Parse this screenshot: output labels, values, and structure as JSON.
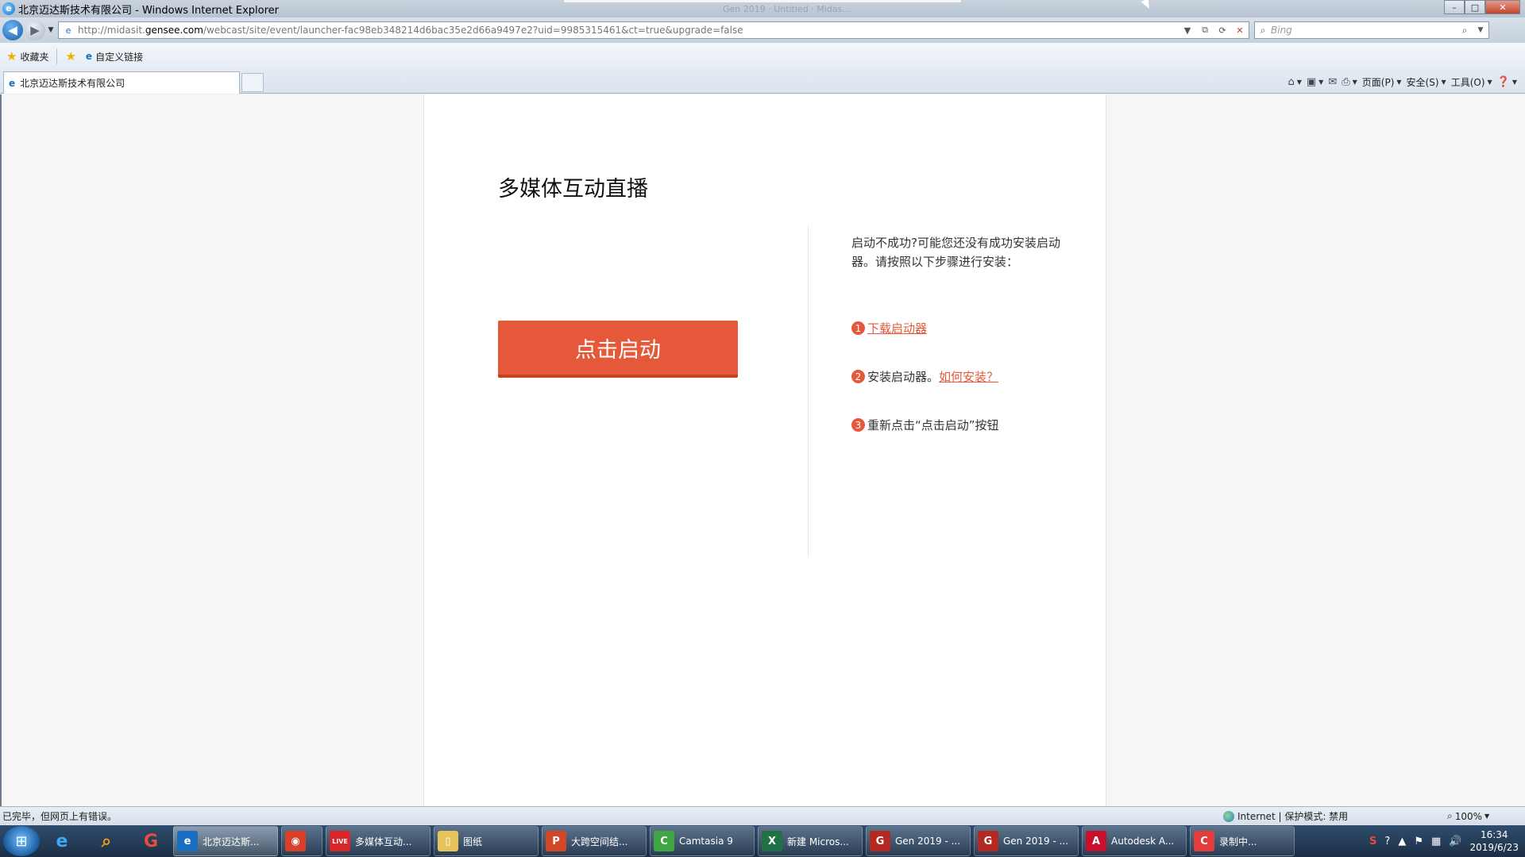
{
  "window": {
    "title": "北京迈达斯技术有限公司 - Windows Internet Explorer",
    "ghost_text": "Gen 2019 · Untitled · Midas...",
    "controls": {
      "minimize": "–",
      "maximize": "□",
      "close": "✕"
    }
  },
  "address": {
    "url_prefix": "http://midasit.",
    "url_domain": "gensee.com",
    "url_rest": "/webcast/site/event/launcher-fac98eb348214d6bac35e2d66a9497e2?uid=9985315461&ct=true&upgrade=false",
    "search_placeholder": "Bing"
  },
  "favorites": {
    "favorites_label": "收藏夹",
    "custom_links_label": "自定义链接"
  },
  "tab": {
    "title": "北京迈达斯技术有限公司"
  },
  "commands": {
    "page": "页面(P)",
    "safety": "安全(S)",
    "tools": "工具(O)"
  },
  "page": {
    "heading": "多媒体互动直播",
    "launch_button": "点击启动",
    "help_intro": "启动不成功?可能您还没有成功安装启动器。请按照以下步骤进行安装：",
    "steps": [
      {
        "num": "1",
        "text": "",
        "link": "下载启动器"
      },
      {
        "num": "2",
        "text": "安装启动器。",
        "link": "如何安装？"
      },
      {
        "num": "3",
        "text": "重新点击“点击启动”按钮",
        "link": ""
      }
    ]
  },
  "status": {
    "text": "已完毕，但网页上有错误。",
    "zone": "Internet | 保护模式: 禁用",
    "zoom": "100%"
  },
  "taskbar": {
    "tasks": [
      {
        "label": "北京迈达斯...",
        "icon": "e",
        "color": "#1a6fc2",
        "active": true
      },
      {
        "label": "",
        "icon": "◉",
        "color": "#d9402b",
        "active": false
      },
      {
        "label": "多媒体互动...",
        "icon": "LIVE",
        "color": "#d9262b",
        "active": false
      },
      {
        "label": "图纸",
        "icon": "▯",
        "color": "#e8c25a",
        "active": false
      },
      {
        "label": "大跨空间结...",
        "icon": "P",
        "color": "#d24726",
        "active": false
      },
      {
        "label": "Camtasia 9",
        "icon": "C",
        "color": "#3ea743",
        "active": false
      },
      {
        "label": "新建 Micros...",
        "icon": "X",
        "color": "#1f7244",
        "active": false
      },
      {
        "label": "Gen 2019 - ...",
        "icon": "G",
        "color": "#b42a22",
        "active": false
      },
      {
        "label": "Gen 2019 - ...",
        "icon": "G",
        "color": "#b42a22",
        "active": false
      },
      {
        "label": "Autodesk A...",
        "icon": "A",
        "color": "#c8102e",
        "active": false
      },
      {
        "label": "录制中...",
        "icon": "C",
        "color": "#e23c3c",
        "active": false
      }
    ],
    "clock_time": "16:34",
    "clock_date": "2019/6/23"
  }
}
